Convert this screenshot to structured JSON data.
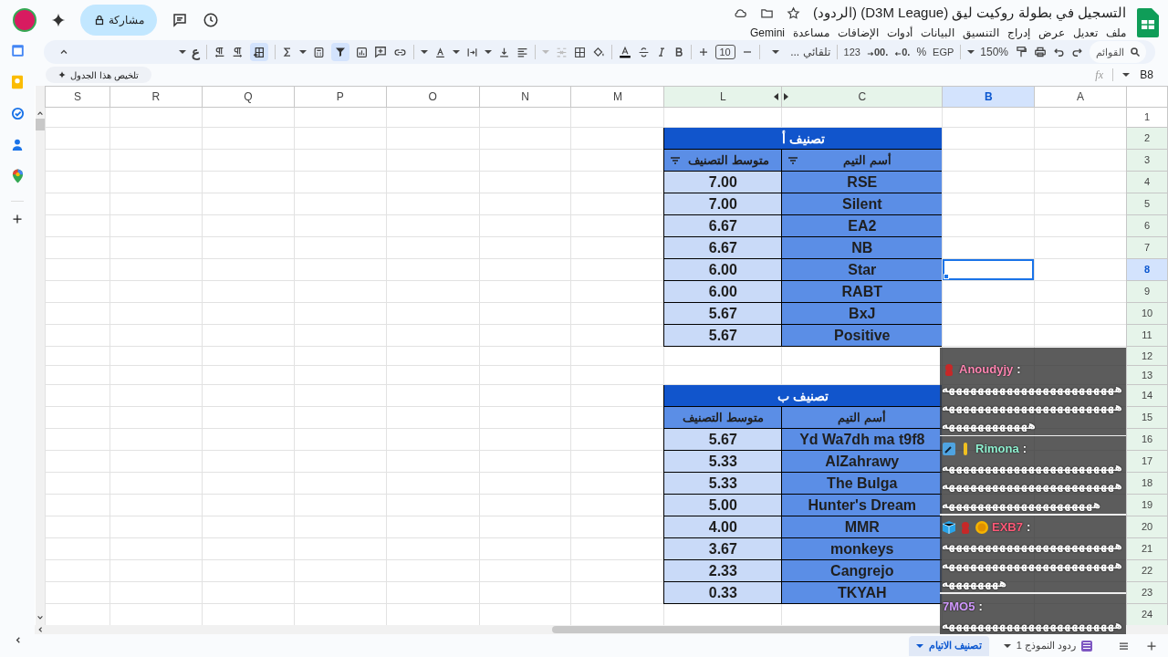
{
  "document": {
    "title": "التسجيل في بطولة روكيت ليق (D3M League) (الردود)",
    "menus": [
      "ملف",
      "تعديل",
      "عرض",
      "إدراج",
      "التنسيق",
      "البيانات",
      "أدوات",
      "الإضافات",
      "مساعدة",
      "Gemini"
    ],
    "share_label": "مشاركة"
  },
  "toolbar": {
    "search_placeholder": "القوائم",
    "zoom": "150%",
    "currency": "EGP",
    "percent": "%",
    "decrease_decimals": ".0",
    "increase_decimals": ".00",
    "number_format": "123",
    "font": "تلقائي ...",
    "font_size": "10",
    "input_tools": "ع",
    "filter_active": true,
    "right_to_left_active": true
  },
  "formula_bar": {
    "name_box": "B8",
    "fx": "fx",
    "summarize_chip": "تلخيص هذا الجدول"
  },
  "sheet": {
    "columns": [
      {
        "label": "A",
        "selected": false,
        "in_filter": false,
        "hidden_columns_after": false
      },
      {
        "label": "B",
        "selected": true,
        "in_filter": false,
        "hidden_columns_after": false
      },
      {
        "label": "C",
        "selected": false,
        "in_filter": true,
        "hidden_columns_after": true
      },
      {
        "label": "L",
        "selected": false,
        "in_filter": true,
        "hidden_columns_after": false
      },
      {
        "label": "M",
        "selected": false,
        "in_filter": false,
        "hidden_columns_after": false
      },
      {
        "label": "N",
        "selected": false,
        "in_filter": false,
        "hidden_columns_after": false
      },
      {
        "label": "O",
        "selected": false,
        "in_filter": false,
        "hidden_columns_after": false
      },
      {
        "label": "P",
        "selected": false,
        "in_filter": false,
        "hidden_columns_after": false
      },
      {
        "label": "Q",
        "selected": false,
        "in_filter": false,
        "hidden_columns_after": false
      },
      {
        "label": "R",
        "selected": false,
        "in_filter": false,
        "hidden_columns_after": false
      },
      {
        "label": "S",
        "selected": false,
        "in_filter": false,
        "hidden_columns_after": false
      }
    ],
    "rows": [
      {
        "label": "1",
        "selected": false,
        "in_filter": false
      },
      {
        "label": "2",
        "selected": false,
        "in_filter": true
      },
      {
        "label": "3",
        "selected": false,
        "in_filter": true
      },
      {
        "label": "4",
        "selected": false,
        "in_filter": true
      },
      {
        "label": "5",
        "selected": false,
        "in_filter": true
      },
      {
        "label": "6",
        "selected": false,
        "in_filter": true
      },
      {
        "label": "7",
        "selected": false,
        "in_filter": true
      },
      {
        "label": "8",
        "selected": true,
        "in_filter": false
      },
      {
        "label": "9",
        "selected": false,
        "in_filter": true
      },
      {
        "label": "10",
        "selected": false,
        "in_filter": true
      },
      {
        "label": "11",
        "selected": false,
        "in_filter": true
      },
      {
        "label": "12",
        "selected": false,
        "in_filter": true
      },
      {
        "label": "13",
        "selected": false,
        "in_filter": true
      },
      {
        "label": "14",
        "selected": false,
        "in_filter": true
      },
      {
        "label": "15",
        "selected": false,
        "in_filter": true
      },
      {
        "label": "16",
        "selected": false,
        "in_filter": true
      },
      {
        "label": "17",
        "selected": false,
        "in_filter": true
      },
      {
        "label": "18",
        "selected": false,
        "in_filter": true
      },
      {
        "label": "19",
        "selected": false,
        "in_filter": true
      },
      {
        "label": "20",
        "selected": false,
        "in_filter": true
      },
      {
        "label": "21",
        "selected": false,
        "in_filter": true
      },
      {
        "label": "22",
        "selected": false,
        "in_filter": true
      },
      {
        "label": "23",
        "selected": false,
        "in_filter": true
      },
      {
        "label": "24",
        "selected": false,
        "in_filter": true
      }
    ],
    "tables": [
      {
        "title": "تصنيف أ",
        "headers": [
          {
            "label": "أسم التيم",
            "filter_button": true
          },
          {
            "label": "متوسط التصنيف",
            "filter_button": true
          }
        ],
        "rows": [
          {
            "team": "RSE",
            "average": "7.00"
          },
          {
            "team": "Silent",
            "average": "7.00"
          },
          {
            "team": "EA2",
            "average": "6.67"
          },
          {
            "team": "NB",
            "average": "6.67"
          },
          {
            "team": "Star",
            "average": "6.00"
          },
          {
            "team": "RABT",
            "average": "6.00"
          },
          {
            "team": "BxJ",
            "average": "5.67"
          },
          {
            "team": "Positive",
            "average": "5.67"
          }
        ]
      },
      {
        "title": "تصنيف ب",
        "headers": [
          {
            "label": "أسم التيم",
            "filter_button": false
          },
          {
            "label": "متوسط التصنيف",
            "filter_button": false
          }
        ],
        "rows": [
          {
            "team": "Yd Wa7dh ma t9f8",
            "average": "5.67"
          },
          {
            "team": "AlZahrawy",
            "average": "5.33"
          },
          {
            "team": "The Bulga",
            "average": "5.33"
          },
          {
            "team": "Hunter's Dream",
            "average": "5.00"
          },
          {
            "team": "MMR",
            "average": "4.00"
          },
          {
            "team": "monkeys",
            "average": "3.67"
          },
          {
            "team": "Cangrejo",
            "average": "2.33"
          },
          {
            "team": "TKYAH",
            "average": "0.33"
          }
        ]
      }
    ]
  },
  "sheet_tabs": [
    {
      "label": "ردود النموذج 1",
      "selected": false,
      "kind": "form"
    },
    {
      "label": "تصنيف الاتيام",
      "selected": true,
      "kind": "sheet"
    }
  ],
  "chat": {
    "messages": [
      {
        "user": "Anoudyjy",
        "suffix": ":",
        "color": "#ff86b2",
        "badges": [
          {
            "kind": "figure"
          }
        ],
        "lines": [
          "ههههههههههههههههههههههههه",
          "ههههههههههههههههههههههههه",
          "ههههههههههههه"
        ]
      },
      {
        "user": "Rimona",
        "suffix": ":",
        "color": "#8ff0d0",
        "badges": [
          {
            "kind": "wrench"
          },
          {
            "kind": "sword"
          }
        ],
        "lines": [
          "ههههههههههههههههههههههههه",
          "ههههههههههههههههههههههههه",
          "هههههههههههههههههههههه"
        ]
      },
      {
        "user": "EXB7",
        "suffix": ":",
        "color": "#ff5a78",
        "badges": [
          {
            "kind": "cube"
          },
          {
            "kind": "figure"
          },
          {
            "kind": "coin"
          }
        ],
        "lines": [
          "ههههههههههههههههههههههههه",
          "ههههههههههههههههههههههههه",
          "ههههههههه"
        ]
      },
      {
        "user": "7MO5",
        "suffix": ":",
        "color": "#d29aff",
        "lines": [
          "ههههههههههههههههههههههههه"
        ]
      }
    ]
  }
}
